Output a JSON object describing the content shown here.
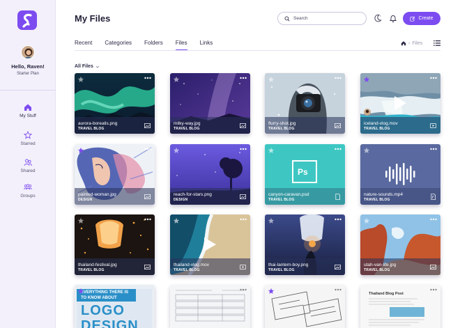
{
  "app": {
    "logo_icon": "brand-s-logo-icon",
    "brand_color": "#7d4cf0"
  },
  "user": {
    "greeting": "Hello, Raven!",
    "plan": "Starter Plan"
  },
  "sidebar": {
    "items": [
      {
        "label": "My Stuff",
        "icon": "home-icon",
        "active": true
      },
      {
        "label": "Starred",
        "icon": "star-icon",
        "active": false
      },
      {
        "label": "Shared",
        "icon": "users-icon",
        "active": false
      },
      {
        "label": "Groups",
        "icon": "group-icon",
        "active": false
      }
    ]
  },
  "header": {
    "title": "My Files",
    "search_placeholder": "Search",
    "create_label": "Create"
  },
  "tabs": [
    {
      "label": "Recent",
      "active": false
    },
    {
      "label": "Categories",
      "active": false
    },
    {
      "label": "Folders",
      "active": false
    },
    {
      "label": "Files",
      "active": true
    },
    {
      "label": "Links",
      "active": false
    }
  ],
  "breadcrumb": {
    "current": "Files"
  },
  "filter": {
    "label": "All Files"
  },
  "files": [
    {
      "name": "aurora-borealis.png",
      "tag": "TRAVEL BLOG",
      "kind": "image",
      "starred": false
    },
    {
      "name": "milky-way.jpg",
      "tag": "TRAVEL BLOG",
      "kind": "image",
      "starred": false
    },
    {
      "name": "flurry-shot.jpg",
      "tag": "TRAVEL BLOG",
      "kind": "image",
      "starred": false
    },
    {
      "name": "iceland-vlog.mov",
      "tag": "TRAVEL BLOG",
      "kind": "video",
      "starred": true
    },
    {
      "name": "painted-woman.jpg",
      "tag": "DESIGN",
      "kind": "image",
      "starred": true
    },
    {
      "name": "reach-for-stars.png",
      "tag": "DESIGN",
      "kind": "image",
      "starred": false
    },
    {
      "name": "canyon-caravan.psd",
      "tag": "TRAVEL BLOG",
      "kind": "document",
      "starred": false
    },
    {
      "name": "nature-sounds.mp4",
      "tag": "TRAVEL BLOG",
      "kind": "audio",
      "starred": false
    },
    {
      "name": "thailand-festival.jpg",
      "tag": "TRAVEL BLOG",
      "kind": "image",
      "starred": false
    },
    {
      "name": "thailand-vlog.mov",
      "tag": "TRAVEL BLOG",
      "kind": "video",
      "starred": false
    },
    {
      "name": "thai-lantern-boy.png",
      "tag": "TRAVEL BLOG",
      "kind": "image",
      "starred": false
    },
    {
      "name": "utah-van-life.jpg",
      "tag": "TRAVEL BLOG",
      "kind": "image",
      "starred": false
    }
  ],
  "partial_cards": {
    "logo_card_lines": [
      "EVERYTHING THERE IS",
      "TO KNOW ABOUT"
    ],
    "logo_card_big": [
      "LOGO",
      "DESIGN"
    ],
    "psd_label": "Ps",
    "blog_post_title": "Thailand Blog Post"
  }
}
